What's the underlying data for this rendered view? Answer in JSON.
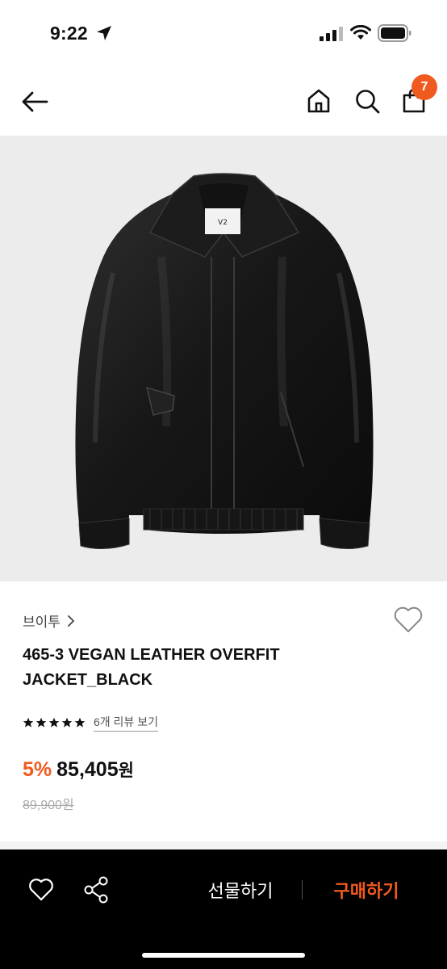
{
  "status": {
    "time": "9:22"
  },
  "header": {
    "back_icon": "arrow-left-icon",
    "home_icon": "home-icon",
    "search_icon": "search-icon",
    "cart_icon": "shopping-bag-icon",
    "cart_count": "7"
  },
  "product": {
    "image_label": "V2",
    "brand": "브이투",
    "name": "465-3 VEGAN LEATHER OVERFIT JACKET_BLACK",
    "rating_stars": 5,
    "review_link": "6개 리뷰 보기",
    "discount": "5%",
    "sale_price": "85,405",
    "price_unit": "원",
    "original_price": "89,900원"
  },
  "bottom_bar": {
    "gift_label": "선물하기",
    "buy_label": "구매하기"
  },
  "colors": {
    "accent": "#f05a1f",
    "bar": "#000000"
  }
}
